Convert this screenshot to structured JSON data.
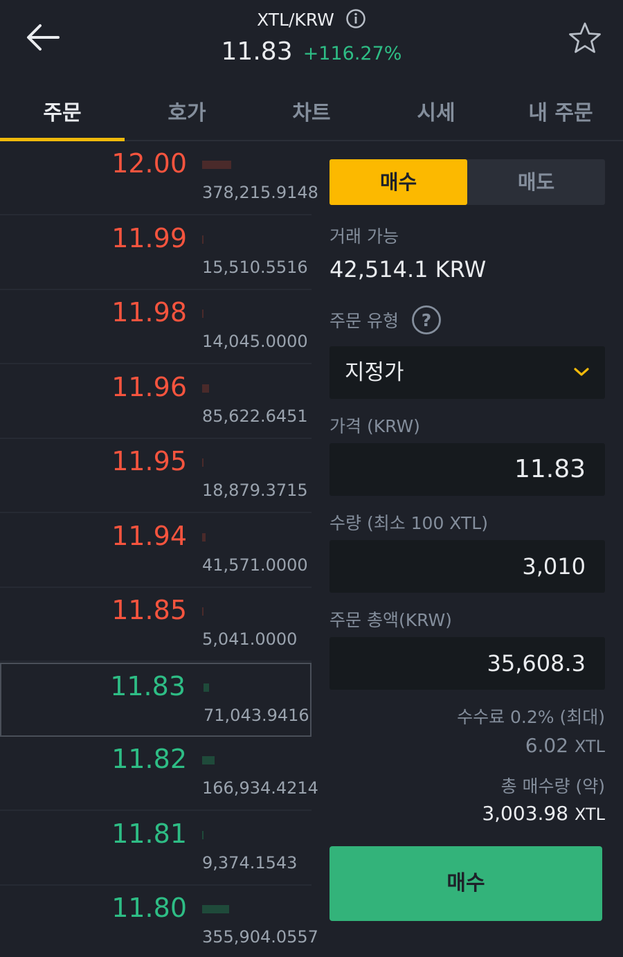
{
  "header": {
    "pair": "XTL/KRW",
    "last_price": "11.83",
    "change": "+116.27%"
  },
  "tabs": [
    {
      "label": "주문",
      "active": true
    },
    {
      "label": "호가",
      "active": false
    },
    {
      "label": "차트",
      "active": false
    },
    {
      "label": "시세",
      "active": false
    },
    {
      "label": "내 주문",
      "active": false
    }
  ],
  "orderbook": {
    "rows": [
      {
        "side": "ask",
        "price": "12.00",
        "qty": "378,215.9148",
        "depth": 1.0
      },
      {
        "side": "ask",
        "price": "11.99",
        "qty": "15,510.5516",
        "depth": 0.04
      },
      {
        "side": "ask",
        "price": "11.98",
        "qty": "14,045.0000",
        "depth": 0.04
      },
      {
        "side": "ask",
        "price": "11.96",
        "qty": "85,622.6451",
        "depth": 0.23
      },
      {
        "side": "ask",
        "price": "11.95",
        "qty": "18,879.3715",
        "depth": 0.05
      },
      {
        "side": "ask",
        "price": "11.94",
        "qty": "41,571.0000",
        "depth": 0.11
      },
      {
        "side": "ask",
        "price": "11.85",
        "qty": "5,041.0000",
        "depth": 0.013
      },
      {
        "side": "bid",
        "price": "11.83",
        "qty": "71,043.9416",
        "depth": 0.19,
        "current": true
      },
      {
        "side": "bid",
        "price": "11.82",
        "qty": "166,934.4214",
        "depth": 0.44
      },
      {
        "side": "bid",
        "price": "11.81",
        "qty": "9,374.1543",
        "depth": 0.025
      },
      {
        "side": "bid",
        "price": "11.80",
        "qty": "355,904.0557",
        "depth": 0.94
      }
    ]
  },
  "order_form": {
    "buy_tab": "매수",
    "sell_tab": "매도",
    "available_label": "거래 가능",
    "available_value": "42,514.1 KRW",
    "order_type_label": "주문 유형",
    "help_glyph": "?",
    "order_type_value": "지정가",
    "price_label": "가격 (KRW)",
    "price_value": "11.83",
    "quantity_label": "수량 (최소 100 XTL)",
    "quantity_value": "3,010",
    "total_label": "주문 총액(KRW)",
    "total_value": "35,608.3",
    "fee_label": "수수료 0.2% (최대)",
    "fee_value": "6.02",
    "fee_unit": "XTL",
    "total_qty_label": "총 매수량 (약)",
    "total_qty_value": "3,003.98",
    "total_qty_unit": "XTL",
    "submit_label": "매수"
  },
  "colors": {
    "background": "#1e2129",
    "ask": "#f6543e",
    "bid": "#2ebd85",
    "accent": "#f0b90b",
    "buy_button": "#33b37a"
  }
}
